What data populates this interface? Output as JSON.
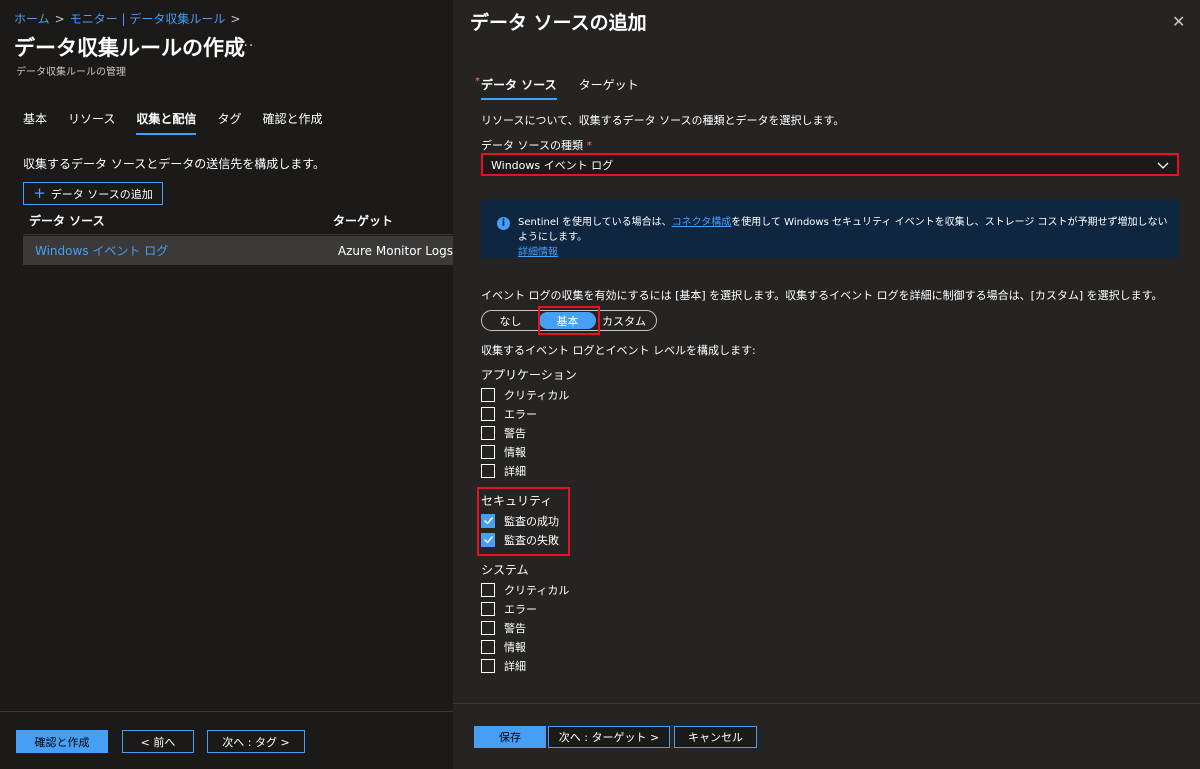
{
  "breadcrumb": {
    "home": "ホーム",
    "monitor": "モニター | データ収集ルール",
    "separator": ">"
  },
  "page": {
    "title": "データ収集ルールの作成",
    "more": "···",
    "subtitle": "データ収集ルールの管理"
  },
  "wizard_tabs": [
    "基本",
    "リソース",
    "収集と配信",
    "タグ",
    "確認と作成"
  ],
  "wizard_active_tab": "収集と配信",
  "collect": {
    "description": "収集するデータ ソースとデータの送信先を構成します。",
    "add_button": "データ ソースの追加",
    "columns": [
      "データ ソース",
      "ターゲット"
    ],
    "rows": [
      {
        "source": "Windows イベント ログ",
        "target": "Azure Monitor Logs"
      }
    ]
  },
  "left_footer": {
    "review": "確認と作成",
    "prev": "< 前へ",
    "next": "次へ : タグ >"
  },
  "panel": {
    "title": "データ ソースの追加",
    "close": "✕",
    "tabs": [
      "データ ソース",
      "ターゲット"
    ],
    "active_tab": "データ ソース",
    "required_mark": "*",
    "description": "リソースについて、収集するデータ ソースの種類とデータを選択します。",
    "ds_type_label": "データ ソースの種類",
    "ds_type_value": "Windows イベント ログ",
    "info": {
      "part1": "Sentinel を使用している場合は、",
      "link1": "コネクタ構成",
      "part2": "を使用して Windows セキュリティ イベントを収集し、ストレージ コストが予期せず増加しないようにします。",
      "link2": "詳細情報"
    },
    "level_instruction": "イベント ログの収集を有効にするには [基本] を選択します。収集するイベント ログを詳細に制御する場合は、[カスタム] を選択します。",
    "segments": [
      "なし",
      "基本",
      "カスタム"
    ],
    "selected_segment": "基本",
    "configure_label": "収集するイベント ログとイベント レベルを構成します:",
    "groups": {
      "application": {
        "label": "アプリケーション",
        "items": [
          {
            "label": "クリティカル",
            "checked": false
          },
          {
            "label": "エラー",
            "checked": false
          },
          {
            "label": "警告",
            "checked": false
          },
          {
            "label": "情報",
            "checked": false
          },
          {
            "label": "詳細",
            "checked": false
          }
        ]
      },
      "security": {
        "label": "セキュリティ",
        "items": [
          {
            "label": "監査の成功",
            "checked": true
          },
          {
            "label": "監査の失敗",
            "checked": true
          }
        ]
      },
      "system": {
        "label": "システム",
        "items": [
          {
            "label": "クリティカル",
            "checked": false
          },
          {
            "label": "エラー",
            "checked": false
          },
          {
            "label": "警告",
            "checked": false
          },
          {
            "label": "情報",
            "checked": false
          },
          {
            "label": "詳細",
            "checked": false
          }
        ]
      }
    },
    "footer": {
      "save": "保存",
      "next": "次へ : ターゲット >",
      "cancel": "キャンセル"
    }
  },
  "colors": {
    "accent": "#479ef5",
    "highlight": "#e81123",
    "info_bg": "#0e2640"
  }
}
